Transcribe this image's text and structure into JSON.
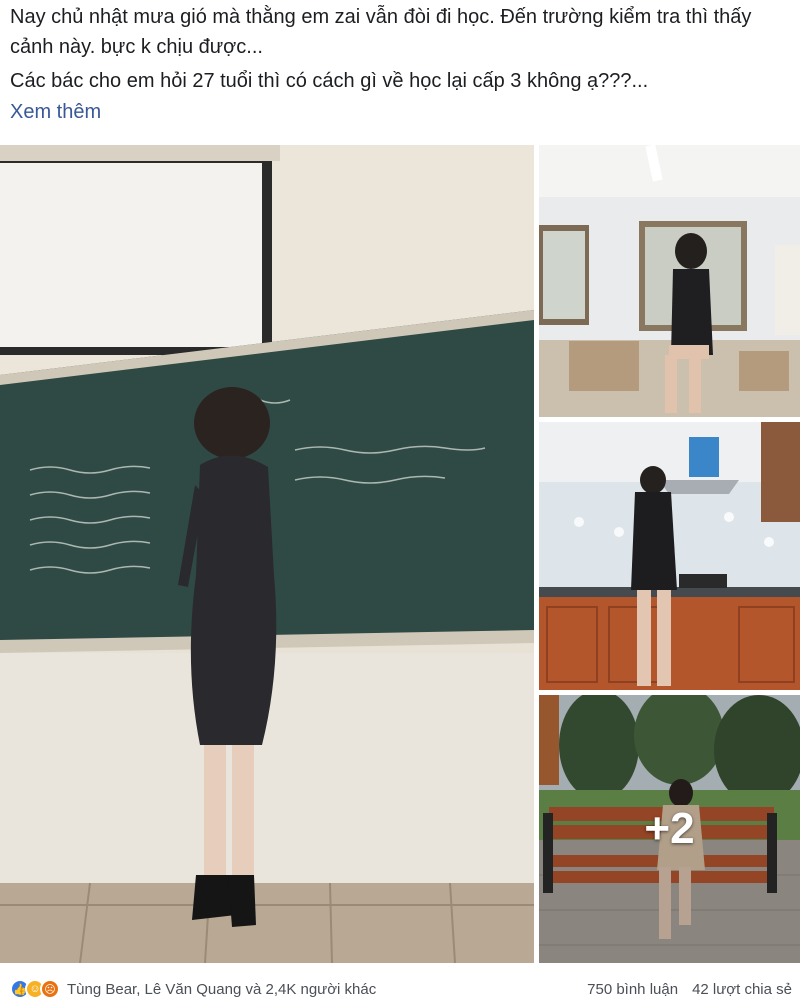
{
  "post": {
    "line1": "Nay chủ nhật mưa gió mà thằng em zai vẫn đòi đi học. Đến trường kiểm tra thì thấy cảnh này.          bực k chịu được...",
    "line2": "Các bác cho em hỏi 27 tuổi thì có cách gì về học lại cấp 3 không ạ???...",
    "see_more": "Xem thêm"
  },
  "gallery": {
    "more_count": "+2"
  },
  "footer": {
    "reaction_icons": [
      "like-icon",
      "haha-icon",
      "angry-icon"
    ],
    "reaction_names": "Tùng Bear, Lê Văn Quang và 2,4K người khác",
    "comments": "750 bình luận",
    "shares": "42 lượt chia sẻ"
  },
  "colors": {
    "link": "#385898",
    "like": "#3578e5",
    "haha": "#f7b125",
    "angry": "#e9710f"
  }
}
